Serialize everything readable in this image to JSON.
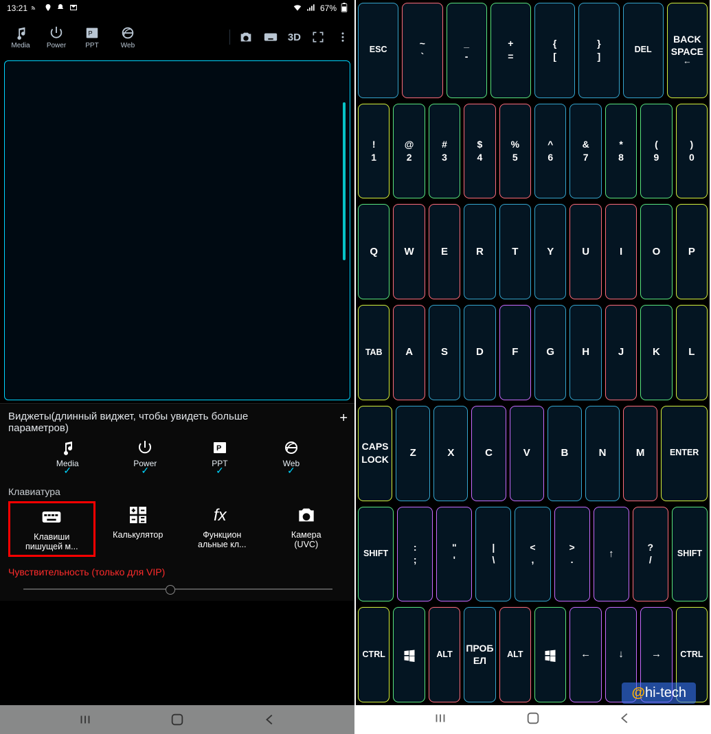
{
  "status": {
    "time": "13:21",
    "battery": "67%"
  },
  "toolbar": {
    "items": [
      {
        "label": "Media"
      },
      {
        "label": "Power"
      },
      {
        "label": "PPT"
      },
      {
        "label": "Web"
      }
    ],
    "right_3d": "3D"
  },
  "sheet": {
    "title": "Виджеты(длинный виджет, чтобы увидеть больше параметров)",
    "widgets": [
      {
        "label": "Media"
      },
      {
        "label": "Power"
      },
      {
        "label": "PPT"
      },
      {
        "label": "Web"
      }
    ],
    "keyboard_label": "Клавиатура",
    "kbd_items": [
      {
        "line1": "Клавиши",
        "line2": "пишущей м..."
      },
      {
        "line1": "Калькулятор",
        "line2": ""
      },
      {
        "line1": "Функцион",
        "line2": "альные кл..."
      },
      {
        "line1": "Камера",
        "line2": "(UVC)"
      }
    ],
    "vip": "Чувствительность (только для VIP)"
  },
  "keyboard": {
    "row1": [
      {
        "t": "ESC",
        "c": "cB",
        "f": 1
      },
      {
        "t": "~\n`",
        "c": "cR"
      },
      {
        "t": "_\n-",
        "c": "cG"
      },
      {
        "t": "+\n=",
        "c": "cG"
      },
      {
        "t": "{\n[",
        "c": "cB"
      },
      {
        "t": "}\n]",
        "c": "cB"
      },
      {
        "t": "DEL",
        "c": "cB",
        "f": 1
      },
      {
        "t": "BACK\nSPACE\n←",
        "c": "cY",
        "f": 1
      }
    ],
    "row2": [
      {
        "t": "!\n1",
        "c": "cY"
      },
      {
        "t": "@\n2",
        "c": "cG"
      },
      {
        "t": "#\n3",
        "c": "cG"
      },
      {
        "t": "$\n4",
        "c": "cR"
      },
      {
        "t": "%\n5",
        "c": "cR"
      },
      {
        "t": "^\n6",
        "c": "cB"
      },
      {
        "t": "&\n7",
        "c": "cB"
      },
      {
        "t": "*\n8",
        "c": "cG"
      },
      {
        "t": "(\n9",
        "c": "cG"
      },
      {
        "t": ")\n0",
        "c": "cY"
      }
    ],
    "row3": [
      {
        "t": "Q",
        "c": "cG"
      },
      {
        "t": "W",
        "c": "cR"
      },
      {
        "t": "E",
        "c": "cR"
      },
      {
        "t": "R",
        "c": "cB"
      },
      {
        "t": "T",
        "c": "cB"
      },
      {
        "t": "Y",
        "c": "cB"
      },
      {
        "t": "U",
        "c": "cR"
      },
      {
        "t": "I",
        "c": "cR"
      },
      {
        "t": "O",
        "c": "cG"
      },
      {
        "t": "P",
        "c": "cY"
      }
    ],
    "row4": [
      {
        "t": "TAB",
        "c": "cY",
        "f": 1
      },
      {
        "t": "A",
        "c": "cR"
      },
      {
        "t": "S",
        "c": "cB"
      },
      {
        "t": "D",
        "c": "cB"
      },
      {
        "t": "F",
        "c": "cM"
      },
      {
        "t": "G",
        "c": "cB"
      },
      {
        "t": "H",
        "c": "cB"
      },
      {
        "t": "J",
        "c": "cR"
      },
      {
        "t": "K",
        "c": "cG"
      },
      {
        "t": "L",
        "c": "cY"
      }
    ],
    "row5": [
      {
        "t": "CAPS\nLOCK",
        "c": "cY",
        "f": 1
      },
      {
        "t": "Z",
        "c": "cB"
      },
      {
        "t": "X",
        "c": "cB"
      },
      {
        "t": "C",
        "c": "cM"
      },
      {
        "t": "V",
        "c": "cM"
      },
      {
        "t": "B",
        "c": "cB"
      },
      {
        "t": "N",
        "c": "cB"
      },
      {
        "t": "M",
        "c": "cR"
      },
      {
        "t": "ENTER",
        "c": "cY",
        "f": 1,
        "w": 1
      }
    ],
    "row6": [
      {
        "t": "SHIFT",
        "c": "cG",
        "f": 1
      },
      {
        "t": ":\n;",
        "c": "cM"
      },
      {
        "t": "\"\n'",
        "c": "cM"
      },
      {
        "t": "|\n\\",
        "c": "cB"
      },
      {
        "t": "<\n,",
        "c": "cB"
      },
      {
        "t": ">\n.",
        "c": "cM"
      },
      {
        "t": "↑",
        "c": "cM"
      },
      {
        "t": "?\n/",
        "c": "cR"
      },
      {
        "t": "SHIFT",
        "c": "cG",
        "f": 1
      }
    ],
    "row7": [
      {
        "t": "CTRL",
        "c": "cY",
        "f": 1
      },
      {
        "t": "⊞",
        "c": "cG"
      },
      {
        "t": "ALT",
        "c": "cR",
        "f": 1
      },
      {
        "t": "ПРОБ\nЕЛ",
        "c": "cB",
        "f": 1
      },
      {
        "t": "ALT",
        "c": "cR",
        "f": 1
      },
      {
        "t": "⊞",
        "c": "cG"
      },
      {
        "t": "←",
        "c": "cM"
      },
      {
        "t": "↓",
        "c": "cM"
      },
      {
        "t": "→",
        "c": "cM"
      },
      {
        "t": "CTRL",
        "c": "cY",
        "f": 1
      }
    ]
  },
  "watermark": {
    "at": "@",
    "text": "hi-tech"
  }
}
